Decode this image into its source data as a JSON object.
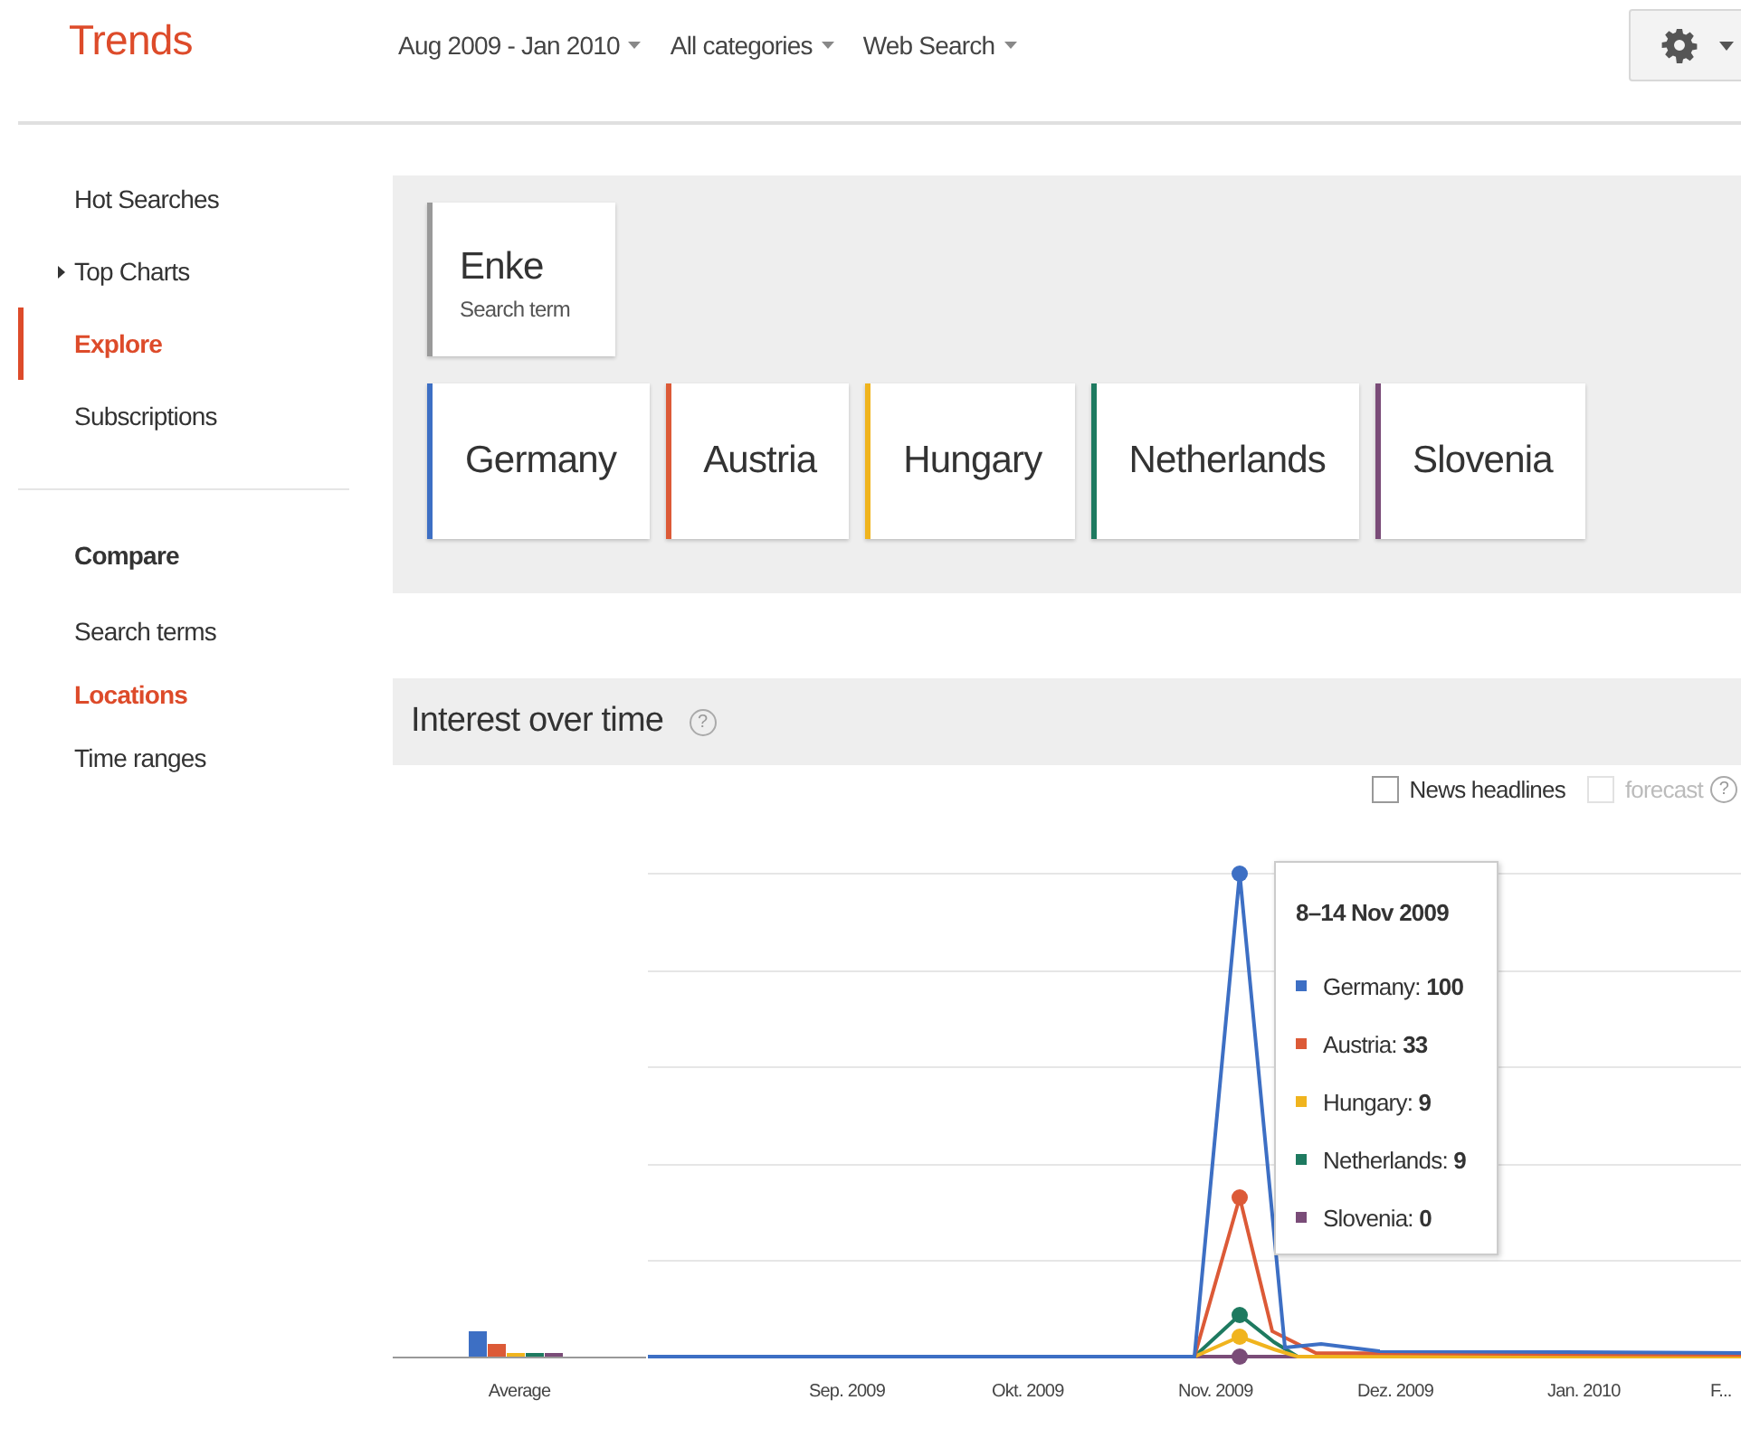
{
  "header": {
    "logo": "Trends",
    "filters": [
      {
        "label": "Aug 2009 - Jan 2010"
      },
      {
        "label": "All categories"
      },
      {
        "label": "Web Search"
      }
    ]
  },
  "sidebar": {
    "items": [
      {
        "label": "Hot Searches",
        "kind": "link",
        "selected": false
      },
      {
        "label": "Top Charts",
        "kind": "expandable",
        "selected": false
      },
      {
        "label": "Explore",
        "kind": "link",
        "selected": true
      },
      {
        "label": "Subscriptions",
        "kind": "link",
        "selected": false
      }
    ],
    "compare": {
      "heading": "Compare",
      "items": [
        {
          "label": "Search terms",
          "selected": false
        },
        {
          "label": "Locations",
          "selected": true
        },
        {
          "label": "Time ranges",
          "selected": false
        }
      ]
    }
  },
  "search_term": {
    "term": "Enke",
    "caption": "Search term"
  },
  "locations": [
    {
      "label": "Germany",
      "color": "#3d6fc4"
    },
    {
      "label": "Austria",
      "color": "#dc5a37"
    },
    {
      "label": "Hungary",
      "color": "#f0b41e"
    },
    {
      "label": "Netherlands",
      "color": "#1e7a60"
    },
    {
      "label": "Slovenia",
      "color": "#7a4c78"
    }
  ],
  "interest": {
    "title": "Interest over time",
    "help": "?",
    "options": [
      {
        "label": "News headlines",
        "checked": false,
        "disabled": false
      },
      {
        "label": "forecast",
        "checked": false,
        "disabled": true
      }
    ],
    "forecast_help": "?",
    "average_label": "Average",
    "x_labels": [
      "Sep. 2009",
      "Okt. 2009",
      "Nov. 2009",
      "Dez. 2009",
      "Jan. 2010",
      "F..."
    ],
    "tooltip": {
      "title": "8–14 Nov 2009",
      "rows": [
        {
          "text": "Germany: **100**",
          "color": "#3d6fc4"
        },
        {
          "text": "Austria: **33**",
          "color": "#dc5a37"
        },
        {
          "text": "Hungary: **9**",
          "color": "#f0b41e"
        },
        {
          "text": "Netherlands: **9**",
          "color": "#1e7a60"
        },
        {
          "text": "Slovenia: **0**",
          "color": "#7a4c78"
        }
      ]
    }
  }
}
